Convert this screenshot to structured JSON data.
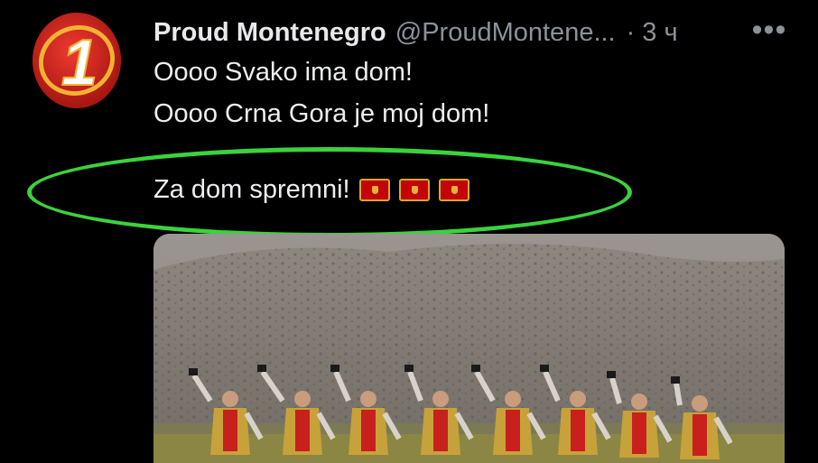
{
  "tweet": {
    "display_name": "Proud Montenegro",
    "handle": "@ProudMontene...",
    "separator": "·",
    "time": "3 ч",
    "more_label": "•••",
    "lines": [
      "Oooo Svako ima dom!",
      "Oooo Crna Gora je moj dom!",
      "Za dom spremni!"
    ],
    "flags": [
      "montenegro-flag-icon",
      "montenegro-flag-icon",
      "montenegro-flag-icon"
    ]
  },
  "avatar": {
    "icon": "number-one-logo-icon",
    "text": "1"
  },
  "annotation": {
    "color": "#3ad33c",
    "shape": "ellipse"
  },
  "media": {
    "type": "photo",
    "description_icon": "dancers-photo"
  },
  "colors": {
    "background": "#000000",
    "text": "#e7e9ea",
    "secondary": "#8b9298",
    "flag_red": "#c40308",
    "flag_gold": "#d3a82e"
  }
}
